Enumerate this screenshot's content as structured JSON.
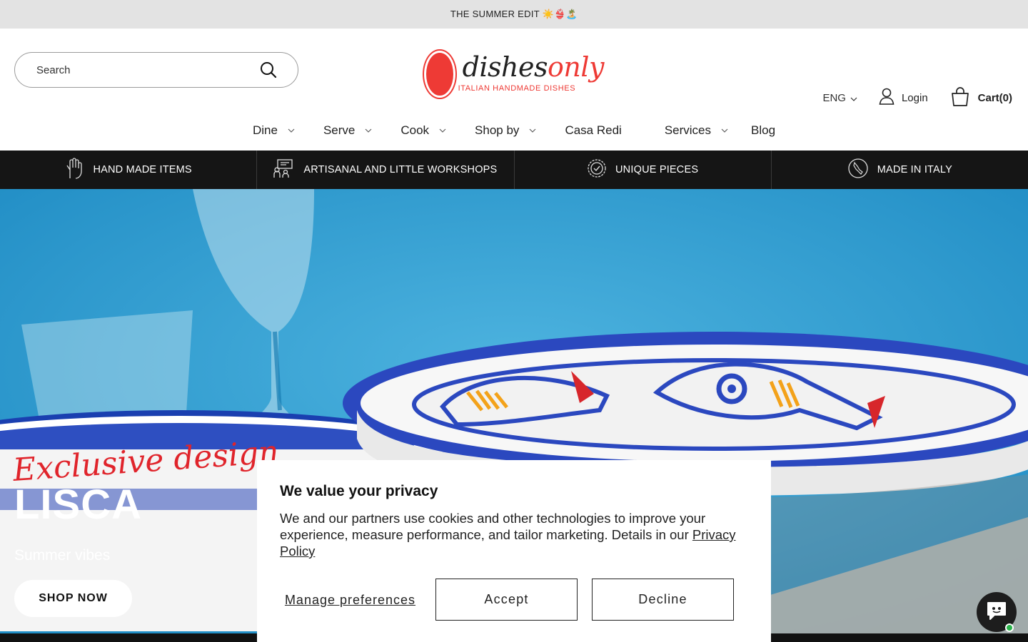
{
  "announcement": {
    "text": "THE SUMMER EDIT ☀️👙🏝️"
  },
  "header": {
    "search": {
      "placeholder": "Search"
    },
    "logo": {
      "word_a": "dishes",
      "word_b": "only",
      "tagline": "ITALIAN HANDMADE DISHES"
    },
    "language": "ENG",
    "login_label": "Login",
    "cart_label": "Cart(0)"
  },
  "nav": {
    "items": [
      {
        "label": "Dine",
        "has_dropdown": true
      },
      {
        "label": "Serve",
        "has_dropdown": true
      },
      {
        "label": "Cook",
        "has_dropdown": true
      },
      {
        "label": "Shop by",
        "has_dropdown": true
      },
      {
        "label": "Casa Redi",
        "has_dropdown": false
      },
      {
        "label": "Services",
        "has_dropdown": true
      },
      {
        "label": "Blog",
        "has_dropdown": false
      }
    ]
  },
  "features": [
    {
      "label": "HAND MADE ITEMS",
      "icon": "hand-icon"
    },
    {
      "label": "ARTISANAL AND LITTLE WORKSHOPS",
      "icon": "workshop-icon"
    },
    {
      "label": "UNIQUE PIECES",
      "icon": "badge-check-icon"
    },
    {
      "label": "MADE IN ITALY",
      "icon": "italy-icon"
    }
  ],
  "hero": {
    "script": "Exclusive design",
    "title": "LISCA",
    "subtitle": "Summer vibes",
    "cta": "SHOP NOW"
  },
  "cookie": {
    "title": "We value your privacy",
    "body": "We and our partners use cookies and other technologies to improve your experience, measure performance, and tailor marketing. Details in our ",
    "link": "Privacy Policy",
    "manage": "Manage preferences",
    "accept": "Accept",
    "decline": "Decline"
  },
  "colors": {
    "brand_red": "#ee3a35",
    "dark_bar": "#151515",
    "announcement_bg": "#e3e3e3"
  }
}
